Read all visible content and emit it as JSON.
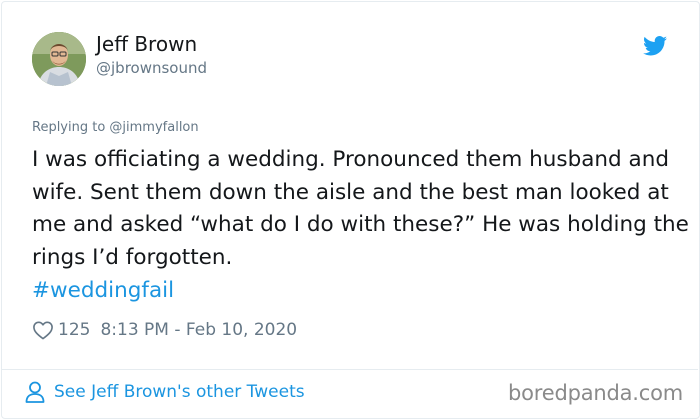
{
  "author": {
    "name": "Jeff Brown",
    "handle": "@jbrownsound",
    "avatar_icon": "profile-photo"
  },
  "brand_icon": "twitter-bird-icon",
  "colors": {
    "accent": "#1b95e0",
    "text": "#14171a",
    "muted": "#657786",
    "border": "#e6ecf0"
  },
  "tweet": {
    "replying_to": "Replying to @jimmyfallon",
    "text": "I was officiating a wedding. Pronounced them husband and wife. Sent them down the aisle and the best man looked at me and asked “what do I do with these?” He was holding the rings I’d forgotten.",
    "hashtag": "#weddingfail",
    "likes": "125",
    "timestamp": "8:13 PM - Feb 10, 2020"
  },
  "footer": {
    "see_more": "See Jeff Brown's other Tweets",
    "watermark": "boredpanda.com"
  }
}
